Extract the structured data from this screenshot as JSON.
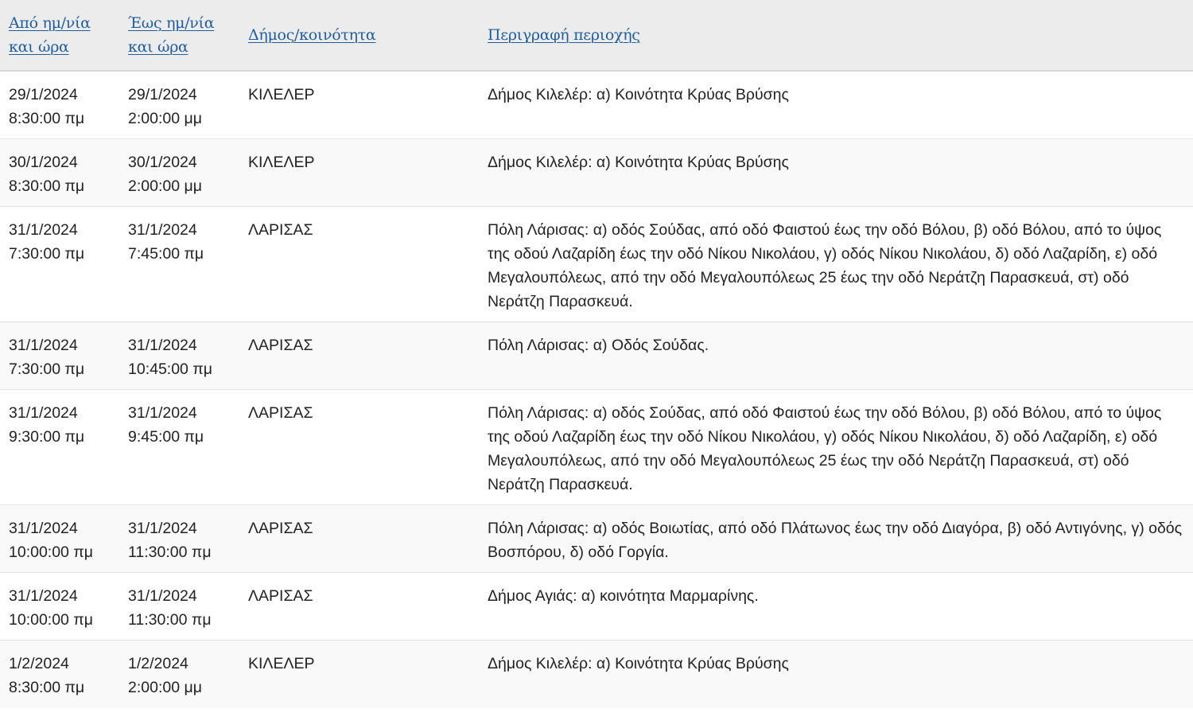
{
  "table": {
    "headers": {
      "from": [
        "Από ημ/νία",
        "και ώρα"
      ],
      "to": [
        "Έως ημ/νία",
        "και ώρα"
      ],
      "municipality": "Δήμος/κοινότητα",
      "description": "Περιγραφή περιοχής"
    },
    "rows": [
      {
        "from_date": "29/1/2024",
        "from_time": "8:30:00 πμ",
        "to_date": "29/1/2024",
        "to_time": "2:00:00 μμ",
        "municipality": "ΚΙΛΕΛΕΡ",
        "description": "Δήμος Κιλελέρ: α) Κοινότητα Κρύας Βρύσης"
      },
      {
        "from_date": "30/1/2024",
        "from_time": "8:30:00 πμ",
        "to_date": "30/1/2024",
        "to_time": "2:00:00 μμ",
        "municipality": "ΚΙΛΕΛΕΡ",
        "description": "Δήμος Κιλελέρ: α) Κοινότητα Κρύας Βρύσης"
      },
      {
        "from_date": "31/1/2024",
        "from_time": "7:30:00 πμ",
        "to_date": "31/1/2024",
        "to_time": "7:45:00 πμ",
        "municipality": "ΛΑΡΙΣΑΣ",
        "description": "Πόλη Λάρισας: α) οδός Σούδας, από οδό Φαιστού έως την οδό Βόλου, β) οδό Βόλου, από το ύψος της οδού Λαζαρίδη έως την οδό Νίκου Νικολάου, γ) οδός Νίκου Νικολάου, δ) οδό Λαζαρίδη, ε) οδό Μεγαλουπόλεως, από την οδό Μεγαλουπόλεως 25 έως την οδό Νεράτζη Παρασκευά, στ) οδό Νεράτζη Παρασκευά."
      },
      {
        "from_date": "31/1/2024",
        "from_time": "7:30:00 πμ",
        "to_date": "31/1/2024",
        "to_time": "10:45:00 πμ",
        "municipality": "ΛΑΡΙΣΑΣ",
        "description": "Πόλη Λάρισας: α) Οδός Σούδας."
      },
      {
        "from_date": "31/1/2024",
        "from_time": "9:30:00 πμ",
        "to_date": "31/1/2024",
        "to_time": "9:45:00 πμ",
        "municipality": "ΛΑΡΙΣΑΣ",
        "description": "Πόλη Λάρισας: α) οδός Σούδας, από οδό Φαιστού έως την οδό Βόλου, β) οδό Βόλου, από το ύψος της οδού Λαζαρίδη έως την οδό Νίκου Νικολάου, γ) οδός Νίκου Νικολάου, δ) οδό Λαζαρίδη, ε) οδό Μεγαλουπόλεως, από την οδό Μεγαλουπόλεως 25 έως την οδό Νεράτζη Παρασκευά, στ) οδό Νεράτζη Παρασκευά."
      },
      {
        "from_date": "31/1/2024",
        "from_time": "10:00:00 πμ",
        "to_date": "31/1/2024",
        "to_time": "11:30:00 πμ",
        "municipality": "ΛΑΡΙΣΑΣ",
        "description": "Πόλη Λάρισας: α) οδός Βοιωτίας, από οδό Πλάτωνος έως την οδό Διαγόρα, β) οδό Αντιγόνης, γ) οδός Βοσπόρου, δ) οδό Γοργία."
      },
      {
        "from_date": "31/1/2024",
        "from_time": "10:00:00 πμ",
        "to_date": "31/1/2024",
        "to_time": "11:30:00 πμ",
        "municipality": "ΛΑΡΙΣΑΣ",
        "description": "Δήμος Αγιάς: α) κοινότητα Μαρμαρίνης."
      },
      {
        "from_date": "1/2/2024",
        "from_time": "8:30:00 πμ",
        "to_date": "1/2/2024",
        "to_time": "2:00:00 μμ",
        "municipality": "ΚΙΛΕΛΕΡ",
        "description": "Δήμος Κιλελέρ: α) Κοινότητα Κρύας Βρύσης"
      }
    ]
  }
}
